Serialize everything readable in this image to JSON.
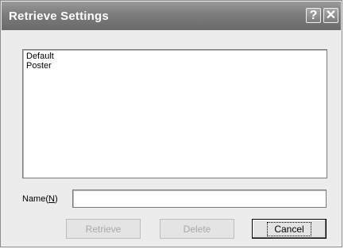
{
  "window": {
    "title": "Retrieve Settings",
    "help_glyph": "?",
    "close_glyph": "✕"
  },
  "settings_list": {
    "items": [
      "Default",
      "Poster"
    ]
  },
  "name_field": {
    "label": "Name",
    "mnemonic": "N",
    "value": ""
  },
  "buttons": {
    "retrieve": "Retrieve",
    "delete": "Delete",
    "cancel": "Cancel"
  }
}
